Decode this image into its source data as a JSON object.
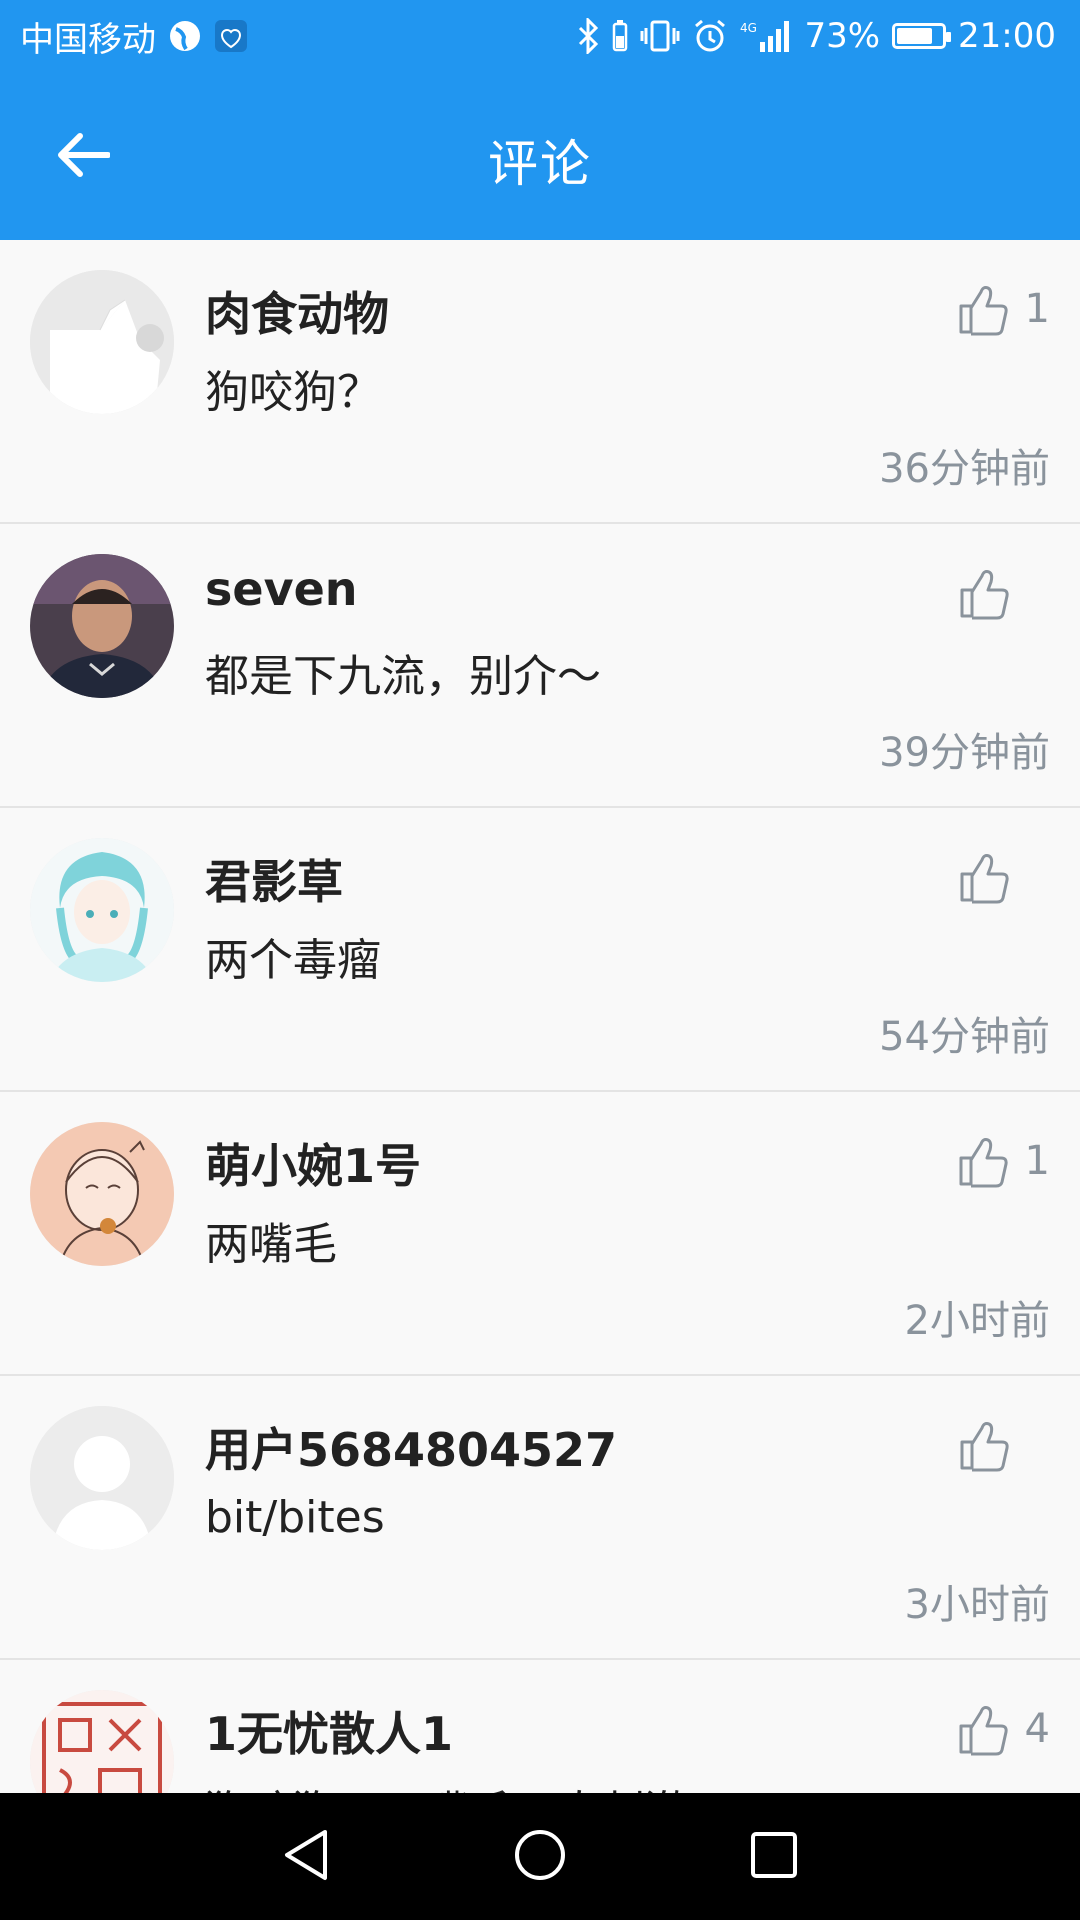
{
  "status_bar": {
    "carrier": "中国移动",
    "battery_percent": "73%",
    "battery_level": 0.73,
    "time": "21:00",
    "network_label": "4G"
  },
  "app_bar": {
    "title": "评论"
  },
  "comments": [
    {
      "username": "肉食动物",
      "text": "狗咬狗？",
      "likes": "1",
      "time": "36分钟前"
    },
    {
      "username": "seven",
      "text": "都是下九流，别介～",
      "likes": "",
      "time": "39分钟前"
    },
    {
      "username": "君影草",
      "text": "两个毒瘤",
      "likes": "",
      "time": "54分钟前"
    },
    {
      "username": "萌小婉1号",
      "text": "两嘴毛",
      "likes": "1",
      "time": "2小时前"
    },
    {
      "username": "用户5684804527",
      "text": "bit/bites",
      "likes": "",
      "time": "3小时前"
    },
    {
      "username": "1无忧散人1",
      "text": "狗咬狗，一嘴毛，真刺激",
      "likes": "4",
      "time": ""
    }
  ],
  "colors": {
    "primary": "#2196f0",
    "muted_text": "#8a939c",
    "divider": "#e4e4e4"
  },
  "icons": {
    "back": "arrow-left-icon",
    "like": "thumbs-up-icon",
    "nav_back": "triangle-back-icon",
    "nav_home": "circle-home-icon",
    "nav_recent": "square-recent-icon"
  }
}
